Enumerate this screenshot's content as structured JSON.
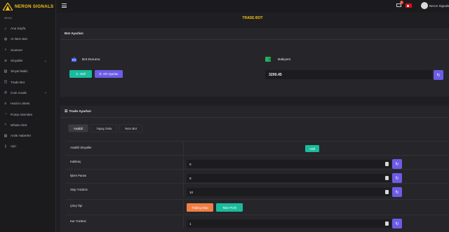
{
  "brand": {
    "name": "NERON SIGNALS"
  },
  "sidebar": {
    "menu_title": "MENU",
    "items": [
      {
        "label": "Ana Sayfa",
        "icon": "home-icon",
        "glyph": "⌂"
      },
      {
        "label": "AI Nero Bot",
        "icon": "robot-icon",
        "glyph": "◍"
      },
      {
        "label": "Scanner",
        "icon": "scanner-icon",
        "glyph": "⌕"
      },
      {
        "label": "Sinyaller",
        "icon": "signal-icon",
        "glyph": "≋",
        "chevron": "⌄"
      },
      {
        "label": "Sinyal Maliz",
        "icon": "chart-icon",
        "glyph": "▥"
      },
      {
        "label": "Trade Bot",
        "icon": "bot-icon",
        "glyph": "◫"
      },
      {
        "label": "Coin Analiz",
        "icon": "coin-icon",
        "glyph": "◎",
        "chevron": "⌄"
      },
      {
        "label": "Hacim Listesi",
        "icon": "volume-icon",
        "glyph": "≡"
      },
      {
        "label": "Pump Alarmları",
        "icon": "alarm-icon",
        "glyph": "◔"
      },
      {
        "label": "Whale Alert",
        "icon": "whale-icon",
        "glyph": "≈"
      },
      {
        "label": "Anlık Haberler",
        "icon": "news-icon",
        "glyph": "▤"
      },
      {
        "label": "Ayrı",
        "icon": "logout-icon",
        "glyph": "▯"
      }
    ]
  },
  "topbar": {
    "notification_count": "1",
    "username": "Neron Signals"
  },
  "page": {
    "title": "TRADE BOT"
  },
  "bot_settings": {
    "header": "Bot Ayarları",
    "status_label": "Bot Durumu",
    "active_button": "Aktif",
    "api_button": "API Ayarları",
    "balance_label": "Bakiyem",
    "balance_value": "3200.45"
  },
  "trade_settings": {
    "header": "Trade Ayarları",
    "tabs": [
      "Analizli",
      "Yapay Zeka",
      "Nero Bot"
    ],
    "rows": [
      {
        "label": "Analizli Sinyaller",
        "button": "Aktif"
      },
      {
        "label": "Kaldıraç",
        "value": "9"
      },
      {
        "label": "İşlem Parası",
        "value": "9"
      },
      {
        "label": "Stop Yüzdesi",
        "value": "10"
      },
      {
        "label": "Çıkış Tipi",
        "option1": "Trailing Stop",
        "option2": "Take Profit"
      },
      {
        "label": "Kar Yüzdesi",
        "value": "1"
      }
    ]
  },
  "colors": {
    "accent": "#f1c40f",
    "teal": "#1abc9c",
    "purple": "#6c5ce7",
    "orange": "#f07e45"
  }
}
